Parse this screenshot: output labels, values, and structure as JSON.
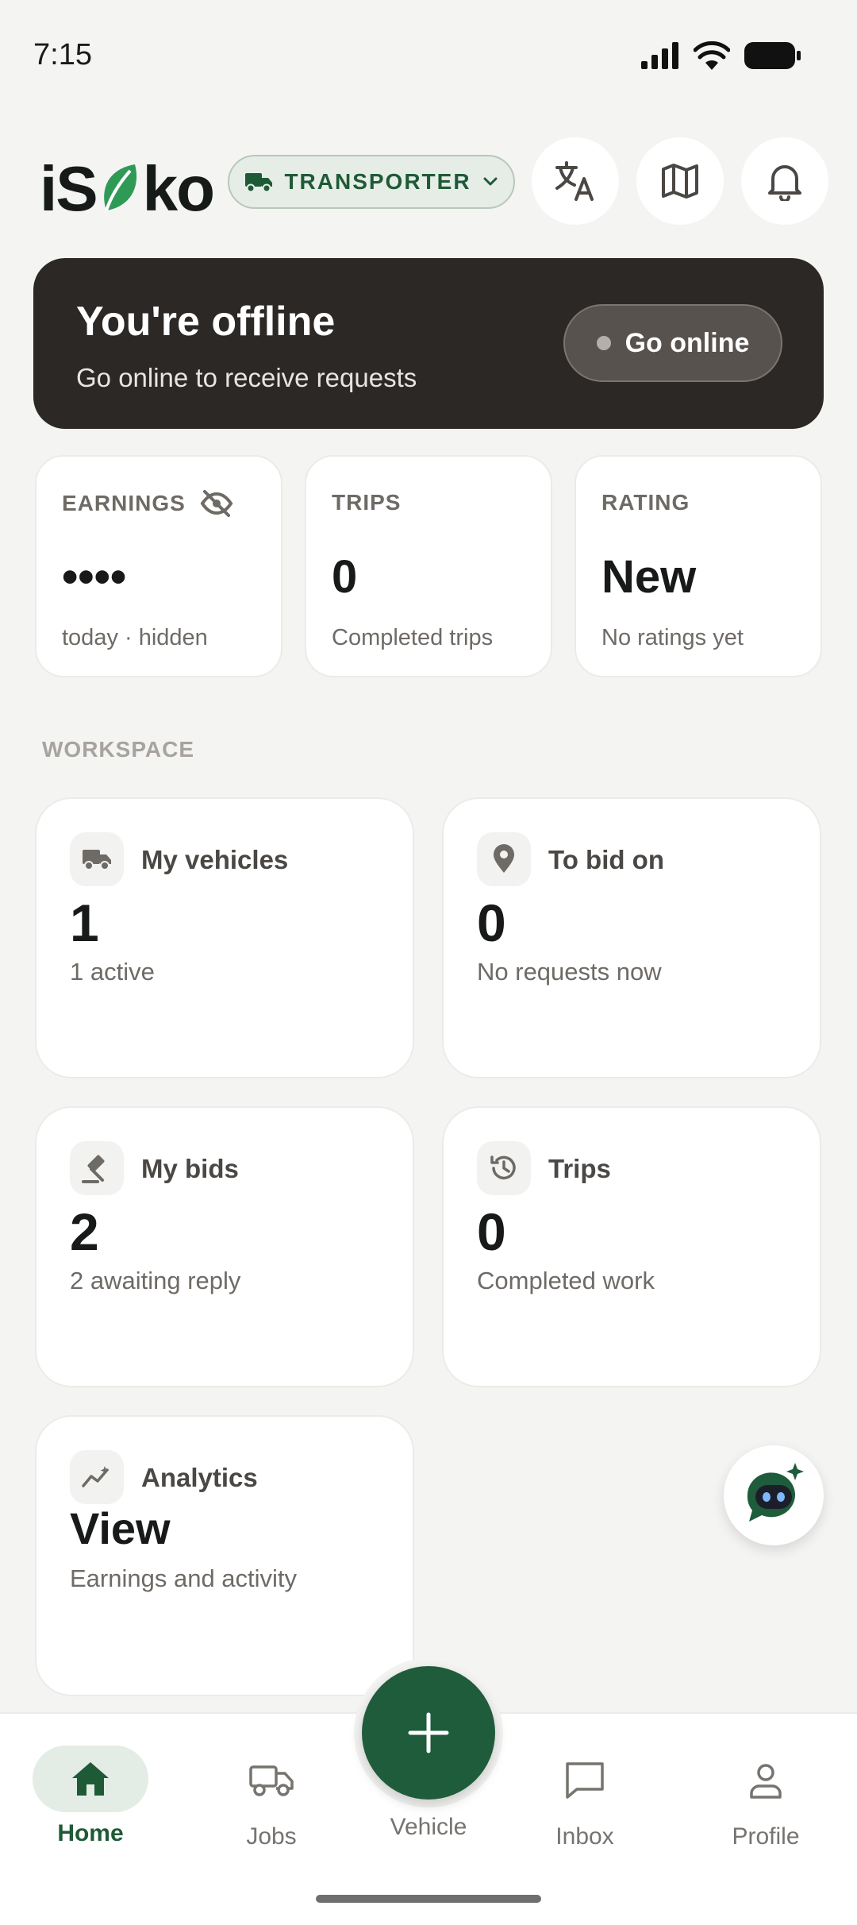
{
  "status_bar": {
    "time": "7:15"
  },
  "header": {
    "logo_left": "iS",
    "logo_right": "ko",
    "role": "TRANSPORTER",
    "icons": [
      "translate-icon",
      "map-icon",
      "bell-icon"
    ]
  },
  "offline_banner": {
    "title": "You're offline",
    "subtitle": "Go online to receive requests",
    "button_label": "Go online"
  },
  "stats": [
    {
      "label": "EARNINGS",
      "value": "••••",
      "sub": "today · hidden",
      "icon": "eye-off-icon"
    },
    {
      "label": "TRIPS",
      "value": "0",
      "sub": "Completed trips"
    },
    {
      "label": "RATING",
      "value": "New",
      "sub": "No ratings yet"
    }
  ],
  "workspace": {
    "label": "WORKSPACE",
    "tiles": [
      {
        "title": "My vehicles",
        "value": "1",
        "sub": "1 active",
        "icon": "truck-icon"
      },
      {
        "title": "To bid on",
        "value": "0",
        "sub": "No requests now",
        "icon": "location-pin-icon"
      },
      {
        "title": "My bids",
        "value": "2",
        "sub": "2 awaiting reply",
        "icon": "gavel-icon"
      },
      {
        "title": "Trips",
        "value": "0",
        "sub": "Completed work",
        "icon": "history-icon"
      },
      {
        "title": "Analytics",
        "value": "View",
        "sub": "Earnings and activity",
        "icon": "trend-icon"
      }
    ]
  },
  "bottom_nav": {
    "items": [
      {
        "label": "Home",
        "icon": "home-icon",
        "active": true
      },
      {
        "label": "Jobs",
        "icon": "truck-icon"
      },
      {
        "label": "Inbox",
        "icon": "chat-icon"
      },
      {
        "label": "Profile",
        "icon": "person-icon"
      }
    ],
    "fab_label": "Vehicle"
  },
  "colors": {
    "brand_green": "#1f5c3b",
    "banner_dark": "#2b2826",
    "background": "#f4f4f2"
  }
}
